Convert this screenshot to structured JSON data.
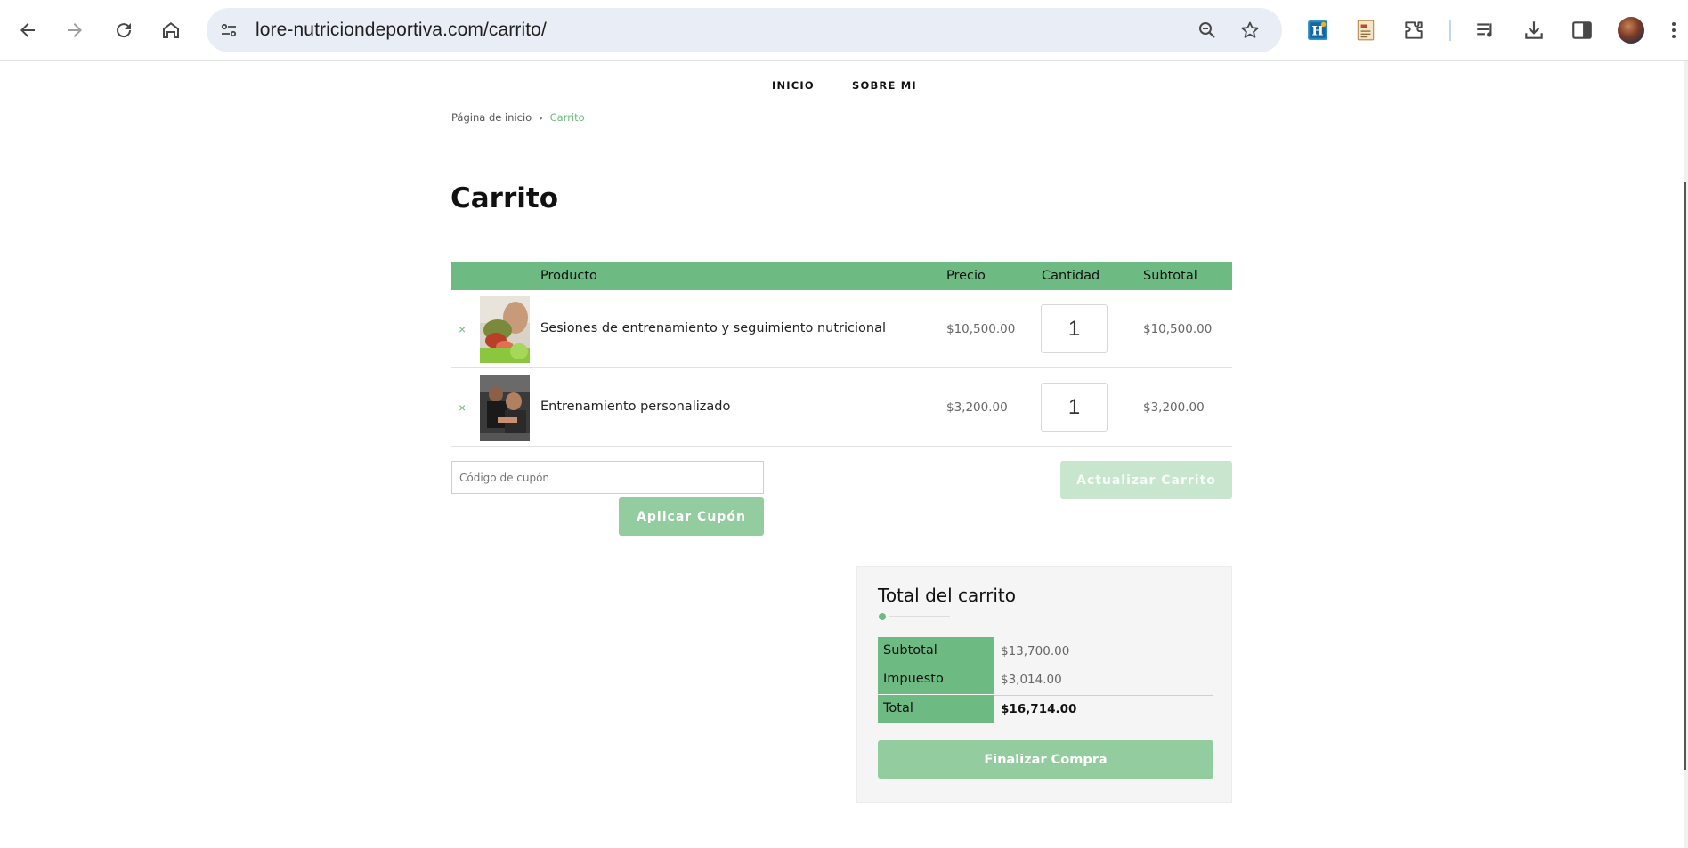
{
  "browser": {
    "url": "lore-nutriciondeportiva.com/carrito/",
    "icons": [
      "back-icon",
      "forward-icon",
      "reload-icon",
      "home-icon",
      "site-info-icon",
      "zoom-icon",
      "star-icon",
      "extension-h-icon",
      "extension-doc-icon",
      "extensions-puzzle-icon",
      "media-queue-icon",
      "download-icon",
      "side-panel-icon",
      "profile-avatar",
      "menu-icon"
    ]
  },
  "site": {
    "nav": [
      "INICIO",
      "SOBRE MI"
    ]
  },
  "breadcrumb": {
    "home": "Página de inicio",
    "separator": "›",
    "current": "Carrito"
  },
  "page": {
    "title": "Carrito"
  },
  "cart": {
    "columns": {
      "product": "Producto",
      "price": "Precio",
      "quantity": "Cantidad",
      "subtotal": "Subtotal"
    },
    "items": [
      {
        "remove": "×",
        "name": "Sesiones de entrenamiento y seguimiento nutricional",
        "price": "$10,500.00",
        "quantity": "1",
        "subtotal": "$10,500.00"
      },
      {
        "remove": "×",
        "name": "Entrenamiento personalizado",
        "price": "$3,200.00",
        "quantity": "1",
        "subtotal": "$3,200.00"
      }
    ],
    "coupon_placeholder": "Código de cupón",
    "apply_coupon": "Aplicar Cupón",
    "update_cart": "Actualizar Carrito"
  },
  "totals": {
    "title": "Total del carrito",
    "subtotal_label": "Subtotal",
    "subtotal_value": "$13,700.00",
    "tax_label": "Impuesto",
    "tax_value": "$3,014.00",
    "total_label": "Total",
    "total_value": "$16,714.00",
    "checkout": "Finalizar Compra"
  },
  "colors": {
    "accent": "#6dbb83",
    "button": "#93cd9f",
    "button_disabled": "#c7e6cd"
  }
}
